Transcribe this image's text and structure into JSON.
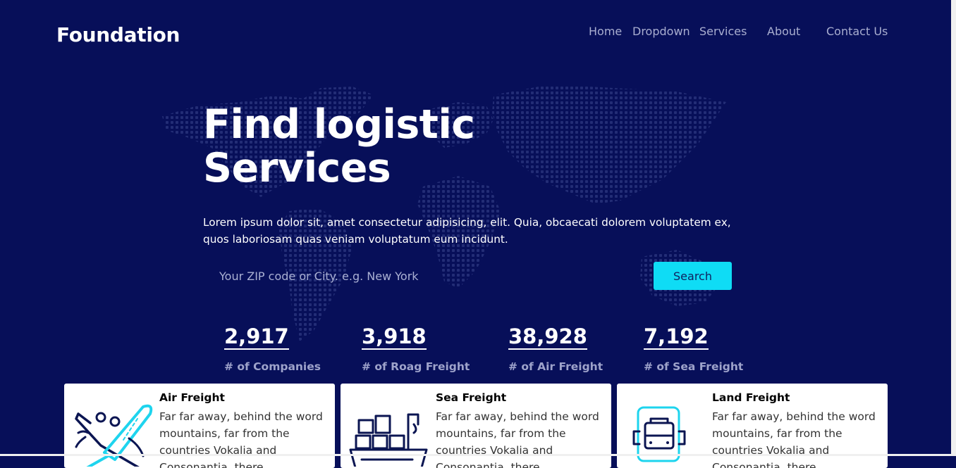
{
  "brand": "Foundation",
  "nav": [
    {
      "label": "Home"
    },
    {
      "label": "Dropdown"
    },
    {
      "label": "Services"
    },
    {
      "label": "About"
    },
    {
      "label": "Contact Us"
    }
  ],
  "hero": {
    "title_line1": "Find logistic",
    "title_line2": "Services",
    "text": "Lorem ipsum dolor sit, amet consectetur adipisicing, elit. Quia, obcaecati dolorem voluptatem ex, quos laboriosam quas veniam voluptatum eum incidunt."
  },
  "search": {
    "placeholder": "Your ZIP code or City. e.g. New York",
    "button_label": "Search"
  },
  "stats": [
    {
      "value": "2,917",
      "label": "# of Companies"
    },
    {
      "value": "3,918",
      "label": "# of Roag Freight"
    },
    {
      "value": "38,928",
      "label": "# of Air Freight"
    },
    {
      "value": "7,192",
      "label": "# of Sea Freight"
    }
  ],
  "services": [
    {
      "title": "Air Freight",
      "icon": "airplane-icon",
      "text": "Far far away, behind the word mountains, far from the countries Vokalia and Consonantia, there"
    },
    {
      "title": "Sea Freight",
      "icon": "cargo-ship-icon",
      "text": "Far far away, behind the word mountains, far from the countries Vokalia and Consonantia, there"
    },
    {
      "title": "Land Freight",
      "icon": "truck-icon",
      "text": "Far far away, behind the word mountains, far from the countries Vokalia and Consonantia, there"
    }
  ],
  "colors": {
    "background": "#070f59",
    "accent": "#0fdcf5",
    "nav_text": "#a9aed0"
  }
}
